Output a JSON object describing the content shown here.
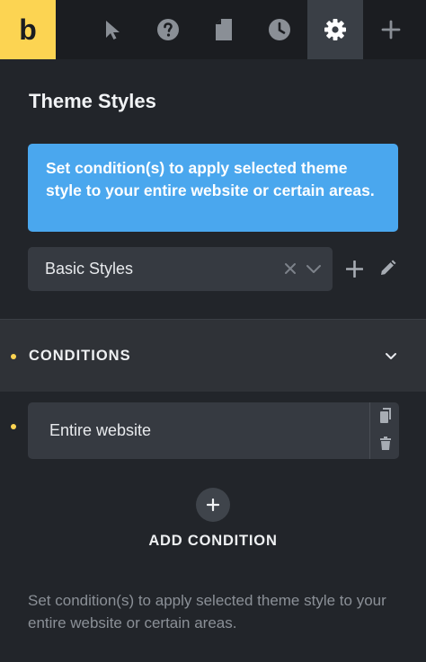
{
  "toolbar": {
    "logo_letter": "b",
    "buttons": [
      {
        "icon": "cursor-icon"
      },
      {
        "icon": "help-icon"
      },
      {
        "icon": "page-icon"
      },
      {
        "icon": "history-icon"
      },
      {
        "icon": "gear-icon",
        "active": true
      },
      {
        "icon": "plus-icon"
      }
    ]
  },
  "panel": {
    "title": "Theme Styles",
    "notice": "Set condition(s) to apply selected theme style to your entire website or certain areas.",
    "style_select": {
      "value": "Basic Styles"
    }
  },
  "conditions": {
    "header": "CONDITIONS",
    "items": [
      {
        "label": "Entire website"
      }
    ],
    "add_label": "ADD CONDITION",
    "help_text": "Set condition(s) to apply selected theme style to your entire website or certain areas."
  },
  "colors": {
    "accent": "#fcd452",
    "notice_bg": "#4aa7ee",
    "panel_bg": "#22252a",
    "toolbar_bg": "#1b1d21"
  }
}
